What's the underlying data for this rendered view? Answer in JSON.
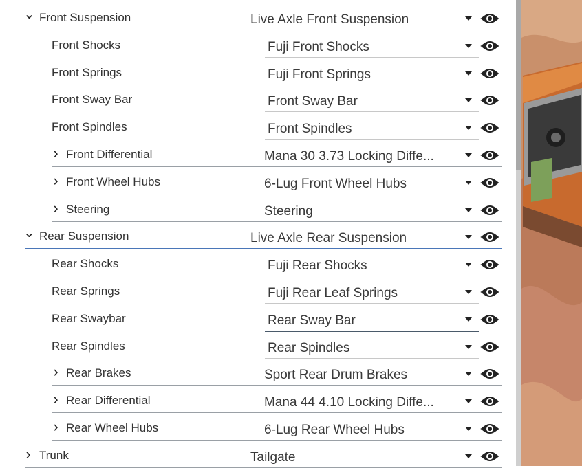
{
  "rows": [
    {
      "label": "Front Suspension",
      "value": "Live Axle Front Suspension",
      "level": 0,
      "expander": "expanded"
    },
    {
      "label": "Front Shocks",
      "value": "Fuji Front Shocks",
      "level": 1,
      "expander": "none"
    },
    {
      "label": "Front Springs",
      "value": "Fuji Front Springs",
      "level": 1,
      "expander": "none"
    },
    {
      "label": "Front Sway Bar",
      "value": "Front Sway Bar",
      "level": 1,
      "expander": "none"
    },
    {
      "label": "Front Spindles",
      "value": "Front Spindles",
      "level": 1,
      "expander": "none"
    },
    {
      "label": "Front Differential",
      "value": "Mana 30 3.73 Locking Diffe...",
      "level": 1,
      "expander": "collapsed"
    },
    {
      "label": "Front Wheel Hubs",
      "value": "6-Lug Front Wheel Hubs",
      "level": 1,
      "expander": "collapsed"
    },
    {
      "label": "Steering",
      "value": "Steering",
      "level": 1,
      "expander": "collapsed"
    },
    {
      "label": "Rear Suspension",
      "value": "Live Axle Rear Suspension",
      "level": 0,
      "expander": "expanded"
    },
    {
      "label": "Rear Shocks",
      "value": "Fuji Rear Shocks",
      "level": 1,
      "expander": "none"
    },
    {
      "label": "Rear Springs",
      "value": "Fuji Rear Leaf Springs",
      "level": 1,
      "expander": "none"
    },
    {
      "label": "Rear Swaybar",
      "value": "Rear Sway Bar",
      "level": 1,
      "expander": "none",
      "focused": true
    },
    {
      "label": "Rear Spindles",
      "value": "Rear Spindles",
      "level": 1,
      "expander": "none"
    },
    {
      "label": "Rear Brakes",
      "value": "Sport Rear Drum Brakes",
      "level": 1,
      "expander": "collapsed"
    },
    {
      "label": "Rear Differential",
      "value": "Mana 44 4.10 Locking Diffe...",
      "level": 1,
      "expander": "collapsed"
    },
    {
      "label": "Rear Wheel Hubs",
      "value": "6-Lug Rear Wheel Hubs",
      "level": 1,
      "expander": "collapsed"
    },
    {
      "label": "Trunk",
      "value": "Tailgate",
      "level": 0,
      "expander": "collapsed"
    }
  ],
  "icons": {
    "expanded": "chevron-down-icon",
    "collapsed": "chevron-right-icon",
    "dropdown": "dropdown-caret-icon",
    "visibility": "eye-icon"
  },
  "colors": {
    "accent_line": "#4a76b8",
    "focus_underline": "#4a5a6a",
    "text": "#333333",
    "icon": "#222222"
  }
}
